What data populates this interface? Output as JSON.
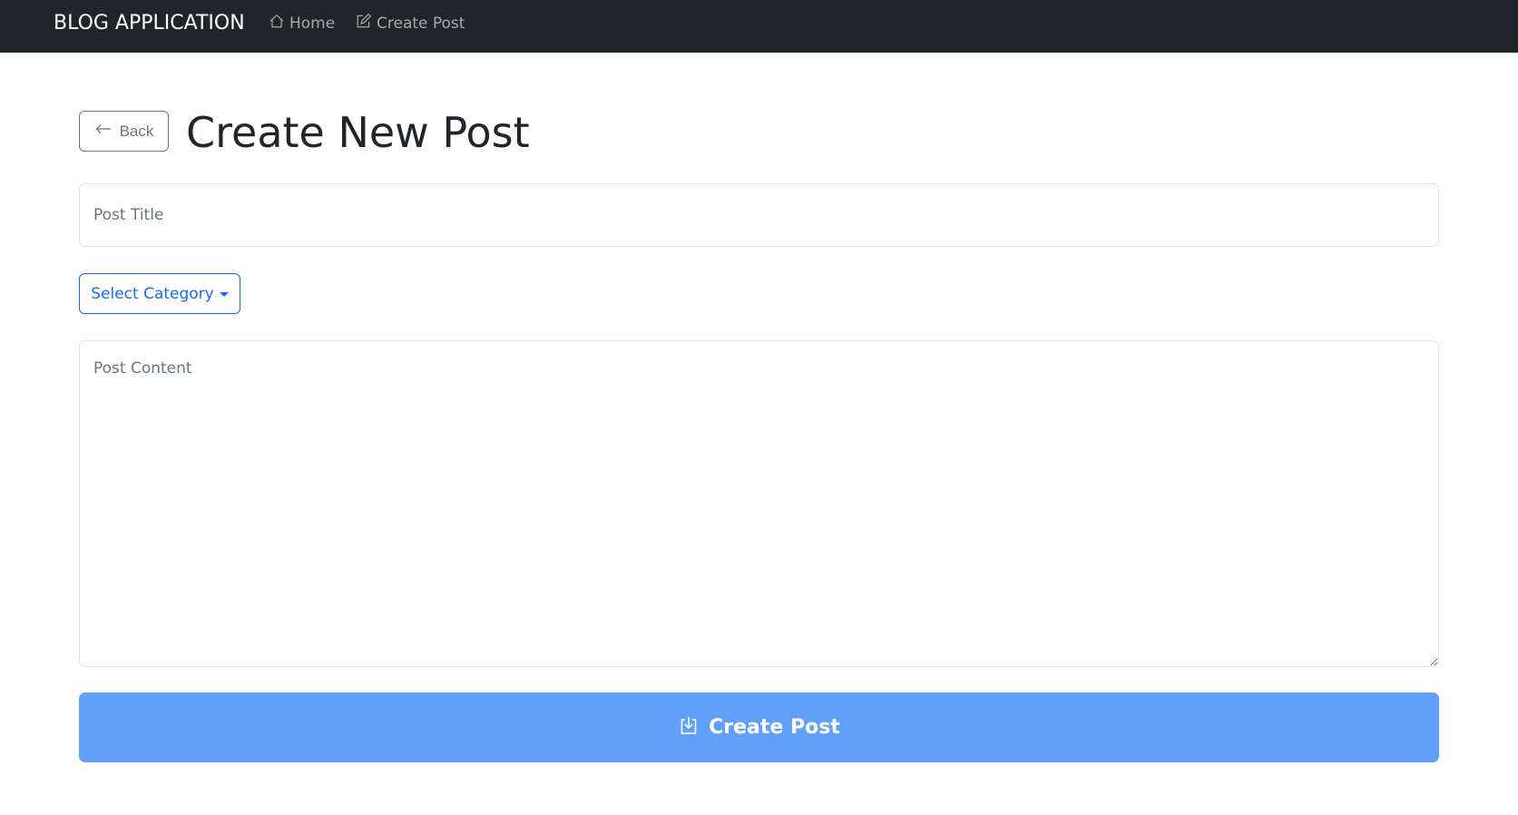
{
  "navbar": {
    "brand": "BLOG APPLICATION",
    "links": [
      {
        "label": "Home",
        "icon": "house-icon"
      },
      {
        "label": "Create Post",
        "icon": "pencil-square-icon"
      }
    ]
  },
  "header": {
    "back_label": "Back",
    "title": "Create New Post"
  },
  "form": {
    "title_placeholder": "Post Title",
    "title_value": "",
    "category_label": "Select Category",
    "content_placeholder": "Post Content",
    "content_value": "",
    "submit_label": "Create Post",
    "submit_icon": "box-arrow-in-down-icon"
  },
  "colors": {
    "navbar_bg": "#212529",
    "primary": "#0d6efd",
    "submit_bg": "#60a0fa",
    "secondary": "#6c757d"
  }
}
